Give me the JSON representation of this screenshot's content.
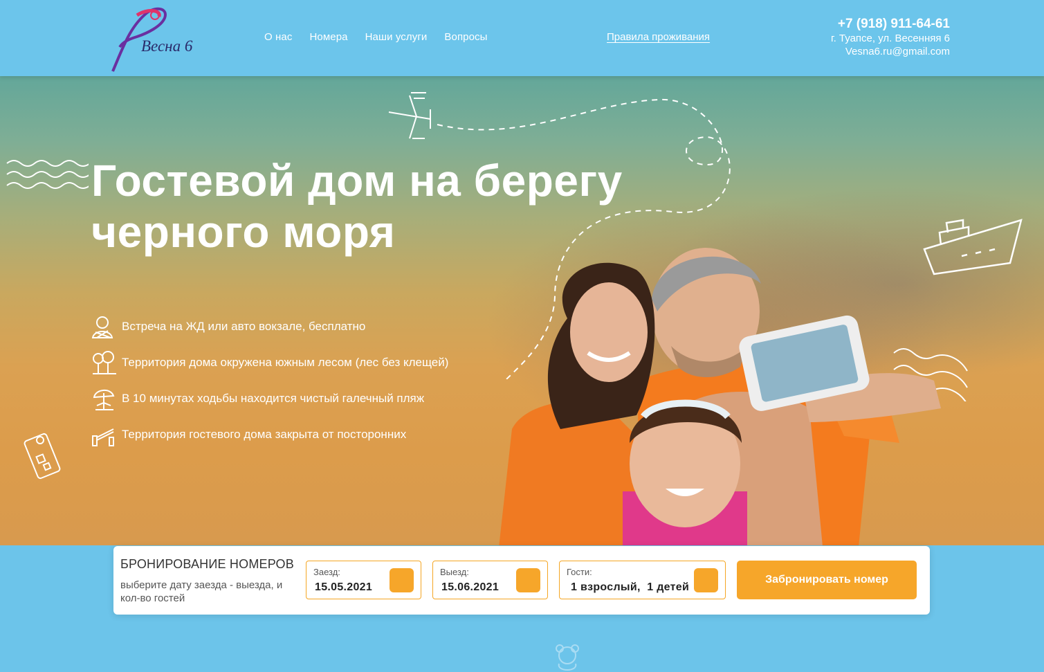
{
  "header": {
    "logo_text": "Весна 6",
    "nav": [
      {
        "label": "О нас"
      },
      {
        "label": "Номера"
      },
      {
        "label": "Наши услуги"
      },
      {
        "label": "Вопросы"
      }
    ],
    "rules_link": "Правила проживания",
    "contacts": {
      "phone": "+7 (918) 911-64-61",
      "address": "г. Туапсе, ул. Весенняя 6",
      "email": "Vesna6.ru@gmail.com"
    }
  },
  "hero": {
    "title_line1": "Гостевой дом на берегу",
    "title_line2": "черного моря",
    "features": [
      {
        "text": "Встреча на ЖД или авто вокзале, бесплатно",
        "icon": "meeting-icon"
      },
      {
        "text": "Территория дома окружена южным лесом (лес без клещей)",
        "icon": "forest-icon"
      },
      {
        "text": "В 10 минутах ходьбы находится чистый галечный пляж",
        "icon": "beach-icon"
      },
      {
        "text": "Территория гостевого дома закрыта от посторонних",
        "icon": "barrier-icon"
      }
    ]
  },
  "booking": {
    "title": "БРОНИРОВАНИЕ НОМЕРОВ",
    "subtitle": "выберите дату заезда - выезда, и кол-во гостей",
    "checkin_label": "Заезд:",
    "checkin_value": "15.05.2021",
    "checkout_label": "Выезд:",
    "checkout_value": "15.06.2021",
    "guests_label": "Гости:",
    "guests_value": "1 взрослый,  1 детей",
    "button_label": "Забронировать номер"
  },
  "colors": {
    "header_bg": "#6cc5eb",
    "accent": "#f6a62a",
    "white": "#ffffff"
  }
}
